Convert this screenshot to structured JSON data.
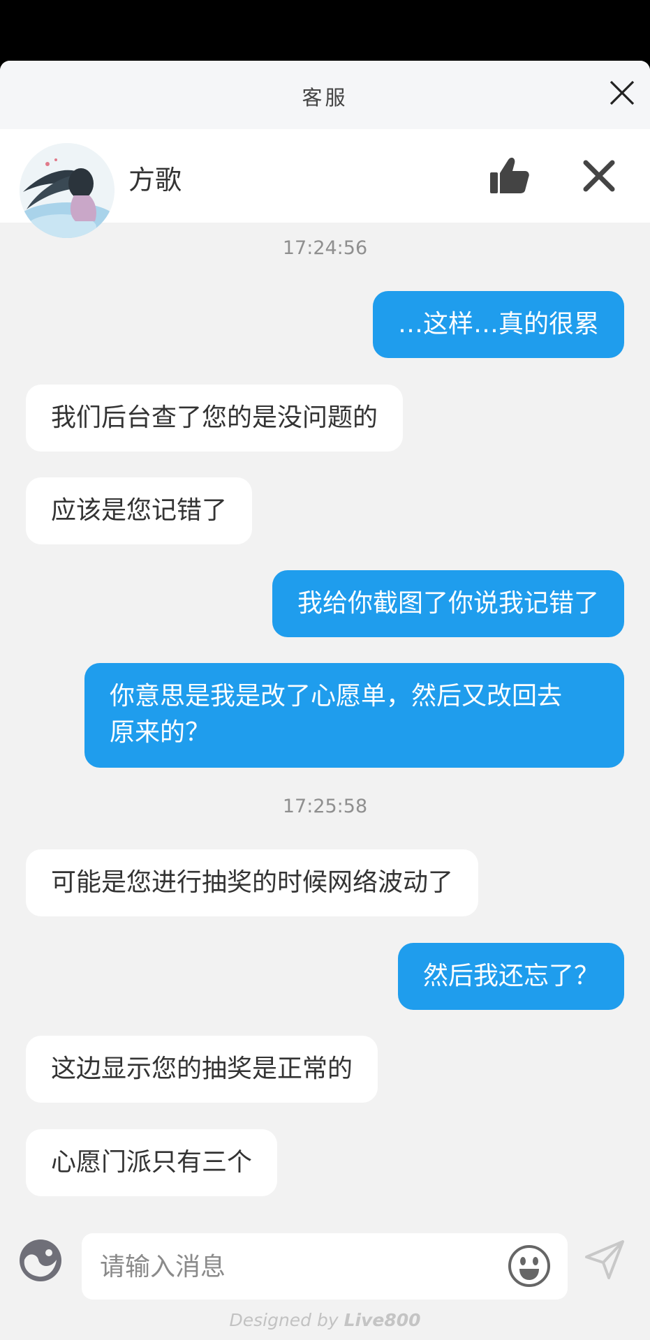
{
  "header": {
    "title": "客服"
  },
  "agent": {
    "name": "方歌"
  },
  "messages": [
    {
      "type": "time",
      "text": "17:24:56"
    },
    {
      "type": "right",
      "text": "…这样…真的很累"
    },
    {
      "type": "left",
      "text": "我们后台查了您的是没问题的"
    },
    {
      "type": "left",
      "text": "应该是您记错了"
    },
    {
      "type": "right",
      "text": "我给你截图了你说我记错了"
    },
    {
      "type": "right",
      "line1": "你意思是我是改了心愿单，然后又改回去",
      "line2": "原来的？"
    },
    {
      "type": "time",
      "text": "17:25:58"
    },
    {
      "type": "left",
      "text": "可能是您进行抽奖的时候网络波动了"
    },
    {
      "type": "right",
      "text": "然后我还忘了？"
    },
    {
      "type": "left",
      "text": "这边显示您的抽奖是正常的"
    },
    {
      "type": "left",
      "text": "心愿门派只有三个"
    }
  ],
  "input": {
    "placeholder": "请输入消息",
    "value": ""
  },
  "footer": {
    "prefix": "Designed by ",
    "brand": "Live800"
  },
  "colors": {
    "outgoing_bubble": "#1f9ded",
    "incoming_bubble": "#ffffff",
    "background": "#f2f2f2"
  },
  "icons": [
    "close-icon",
    "thumbs-up-icon",
    "close-x-icon",
    "face-icon",
    "emoji-icon",
    "send-icon"
  ]
}
